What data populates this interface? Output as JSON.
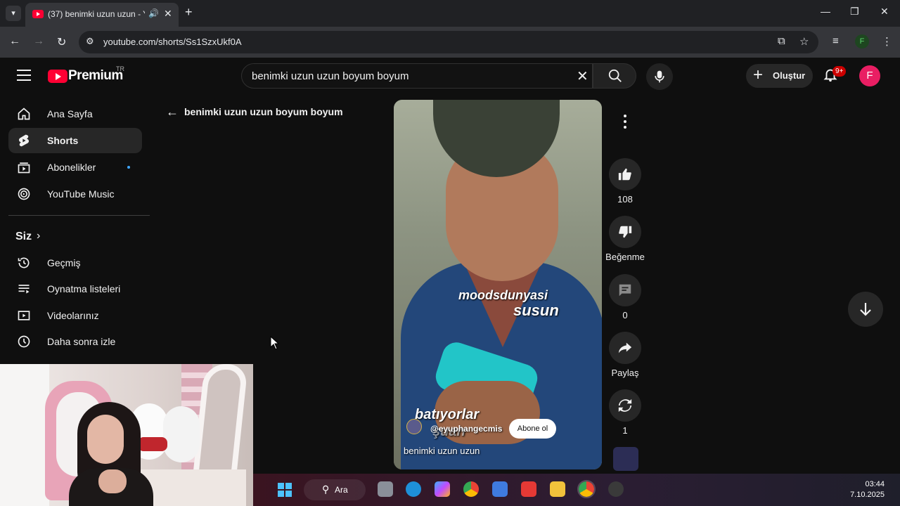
{
  "browser": {
    "tab_title": "(37) benimki uzun uzun - YouTube",
    "url": "youtube.com/shorts/Ss1SzxUkf0A",
    "profile_initial": "F"
  },
  "header": {
    "logo_word": "Premium",
    "logo_region": "TR",
    "search_value": "benimki uzun uzun boyum boyum",
    "create_label": "Oluştur",
    "notif_badge": "9+",
    "avatar_initial": "F"
  },
  "sidebar": {
    "items": [
      {
        "label": "Ana Sayfa",
        "icon": "home-icon"
      },
      {
        "label": "Shorts",
        "icon": "shorts-icon"
      },
      {
        "label": "Abonelikler",
        "icon": "subscriptions-icon"
      },
      {
        "label": "YouTube Music",
        "icon": "youtube-music-icon"
      }
    ],
    "you_label": "Siz",
    "you_items": [
      {
        "label": "Geçmiş",
        "icon": "history-icon"
      },
      {
        "label": "Oynatma listeleri",
        "icon": "playlists-icon"
      },
      {
        "label": "Videolarınız",
        "icon": "your-videos-icon"
      },
      {
        "label": "Daha sonra izle",
        "icon": "watch-later-icon"
      }
    ]
  },
  "shorts": {
    "back_title": "benimki uzun uzun boyum boyum",
    "overlay_top_1": "moodsdunyasi",
    "overlay_top_2": "susun",
    "overlay_bottom_1": "batıyorlar",
    "overlay_bottom_2": "şuan",
    "channel_handle": "@eyuphangecmis",
    "subscribe_label": "Abone ol",
    "video_title": "benimki uzun uzun",
    "likes": "108",
    "dislike_label": "Beğenme",
    "comments": "0",
    "share_label": "Paylaş",
    "remix_count": "1"
  },
  "taskbar": {
    "search_label": "Ara",
    "time": "03:44",
    "date": "7.10.2025"
  },
  "colors": {
    "yt_red": "#ff0033",
    "avatar_pink": "#e91e63",
    "badge_red": "#cc0000",
    "accent_blue": "#3ea6ff"
  }
}
